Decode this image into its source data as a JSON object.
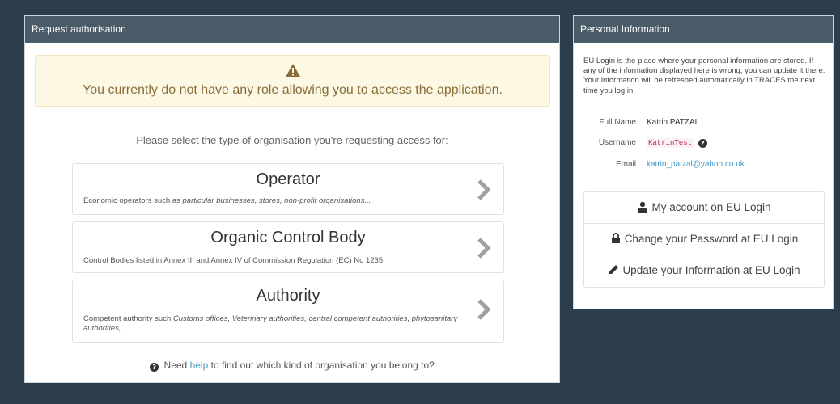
{
  "request_panel": {
    "heading": "Request authorisation",
    "warning_text": "You currently do not have any role allowing you to access the application.",
    "select_prompt": "Please select the type of organisation you're requesting access for:",
    "organisations": [
      {
        "title": "Operator",
        "desc_plain": "Economic operators such as ",
        "desc_italic": "particular businesses, stores, non-profit organisations..."
      },
      {
        "title": "Organic Control Body",
        "desc_plain": "Control Bodies listed in Annex III and Annex IV of Commission Regulation (EC) No 1235",
        "desc_italic": ""
      },
      {
        "title": "Authority",
        "desc_plain": "Competent authority such ",
        "desc_italic": "Customs offices, Veterinary authorities, central competent authorities, phytosanitary authorities,"
      }
    ],
    "help_prefix": "Need",
    "help_link": "help",
    "help_suffix": "to find out which kind of organisation you belong to?"
  },
  "info_panel": {
    "heading": "Personal Information",
    "intro": "EU Login is the place where your personal information are stored. If any of the information displayed here is wrong, you can update it there. Your information will be refreshed automatically in TRACES the next time you log in.",
    "fields": {
      "full_name_label": "Full Name",
      "full_name": "Katrin PATZAL",
      "username_label": "Username",
      "username": "KatrinTest",
      "email_label": "Email",
      "email": "katrin_patzal@yahoo.co.uk"
    },
    "links": {
      "account": "My account on EU Login",
      "password": "Change your Password at EU Login",
      "update": "Update your Information at EU Login"
    }
  },
  "icons": {
    "warning": "warning-triangle-icon",
    "chevron": "chevron-right-icon",
    "question": "question-circle-icon",
    "user": "user-icon",
    "lock": "lock-icon",
    "pencil": "pencil-icon"
  },
  "colors": {
    "background": "#2c3e4c",
    "panel_heading": "#4a5b68",
    "warning_bg": "#fcf8e3",
    "warning_text": "#8a6d3b",
    "link": "#3d9ac8"
  }
}
